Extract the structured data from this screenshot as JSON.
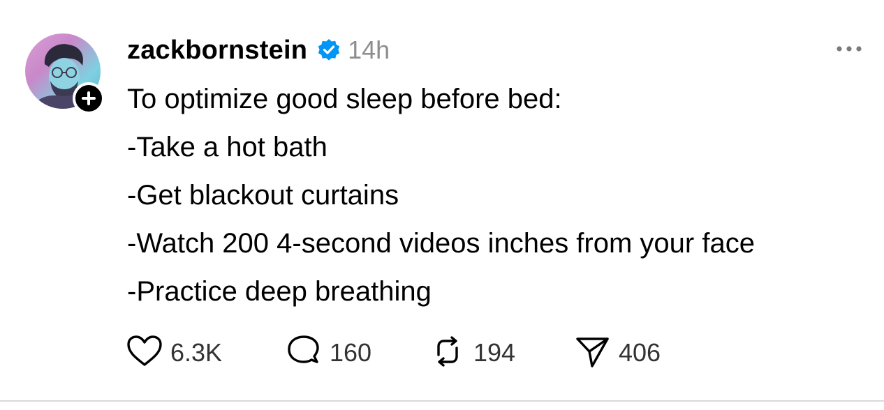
{
  "post": {
    "author": {
      "username": "zackbornstein",
      "verified": true,
      "avatar_icon": "profile-photo",
      "follow_icon": "plus-icon"
    },
    "timestamp": "14h",
    "more_icon": "more-horizontal-icon",
    "lines": [
      "To optimize good sleep before bed:",
      "-Take a hot bath",
      "-Get blackout curtains",
      "-Watch 200 4-second videos inches from your face",
      "-Practice deep breathing"
    ],
    "actions": {
      "like": {
        "icon": "heart-icon",
        "count": "6.3K"
      },
      "reply": {
        "icon": "comment-bubble-icon",
        "count": "160"
      },
      "repost": {
        "icon": "repost-icon",
        "count": "194"
      },
      "share": {
        "icon": "send-icon",
        "count": "406"
      }
    },
    "colors": {
      "verified_blue": "#0095f6",
      "muted_gray": "#8e8e8e"
    }
  }
}
